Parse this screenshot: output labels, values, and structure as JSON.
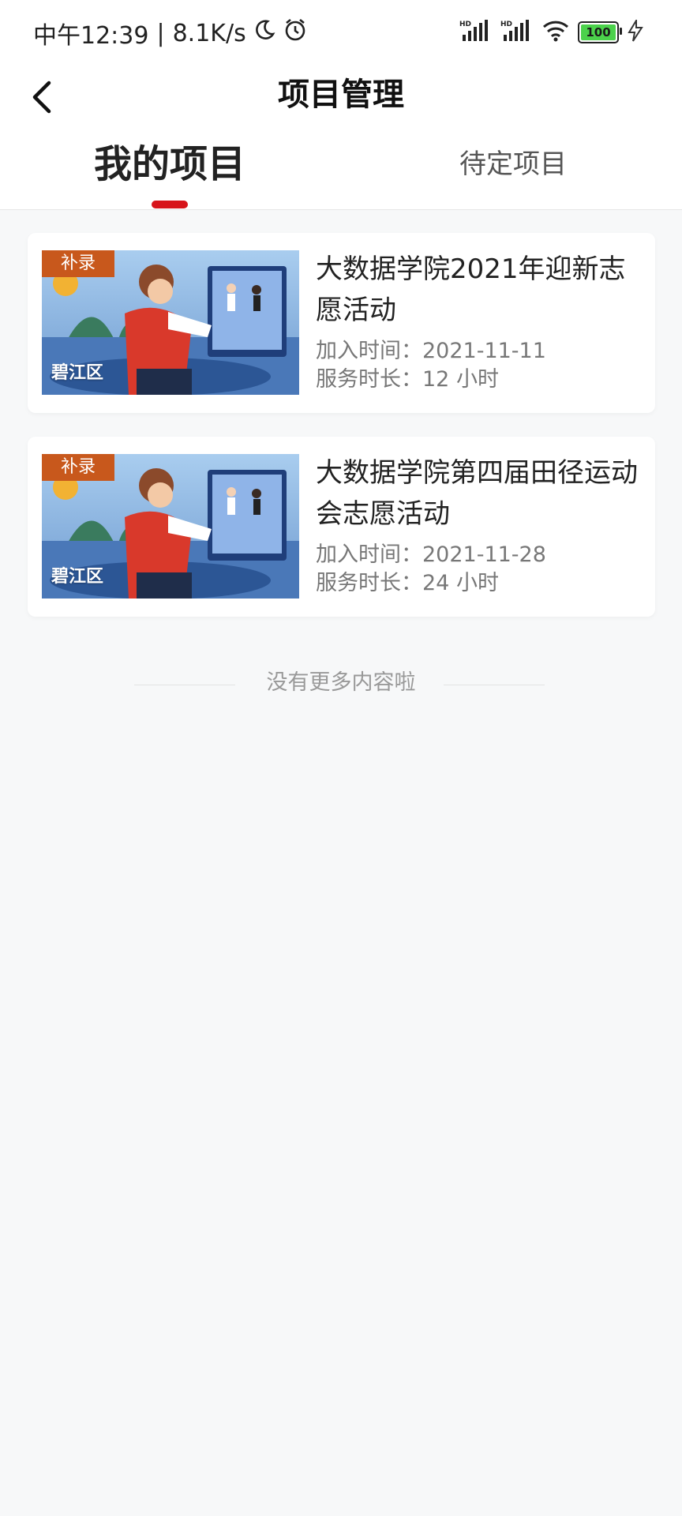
{
  "status_bar": {
    "time": "中午12:39",
    "network_speed": "8.1K/s",
    "signal1_label": "HD",
    "signal2_label": "HD",
    "battery": "100",
    "icons": [
      "moon-icon",
      "alarm-icon",
      "signal-icon",
      "wifi-icon",
      "battery-icon",
      "charging-icon"
    ]
  },
  "header": {
    "title": "项目管理"
  },
  "tabs": [
    {
      "label": "我的项目",
      "active": true
    },
    {
      "label": "待定项目",
      "active": false
    }
  ],
  "projects": [
    {
      "tag": "补录",
      "district": "碧江区",
      "title": "大数据学院2021年迎新志愿活动",
      "join_label": "加入时间：",
      "join_time": "2021-11-11",
      "duration_label": "服务时长：",
      "duration": "12 小时"
    },
    {
      "tag": "补录",
      "district": "碧江区",
      "title": "大数据学院第四届田径运动会志愿活动",
      "join_label": "加入时间：",
      "join_time": "2021-11-28",
      "duration_label": "服务时长：",
      "duration": "24 小时"
    }
  ],
  "footer": {
    "no_more": "没有更多内容啦"
  },
  "colors": {
    "accent": "#d7141a",
    "tag_bg": "#c8581c",
    "page_bg": "#f7f8f9"
  }
}
